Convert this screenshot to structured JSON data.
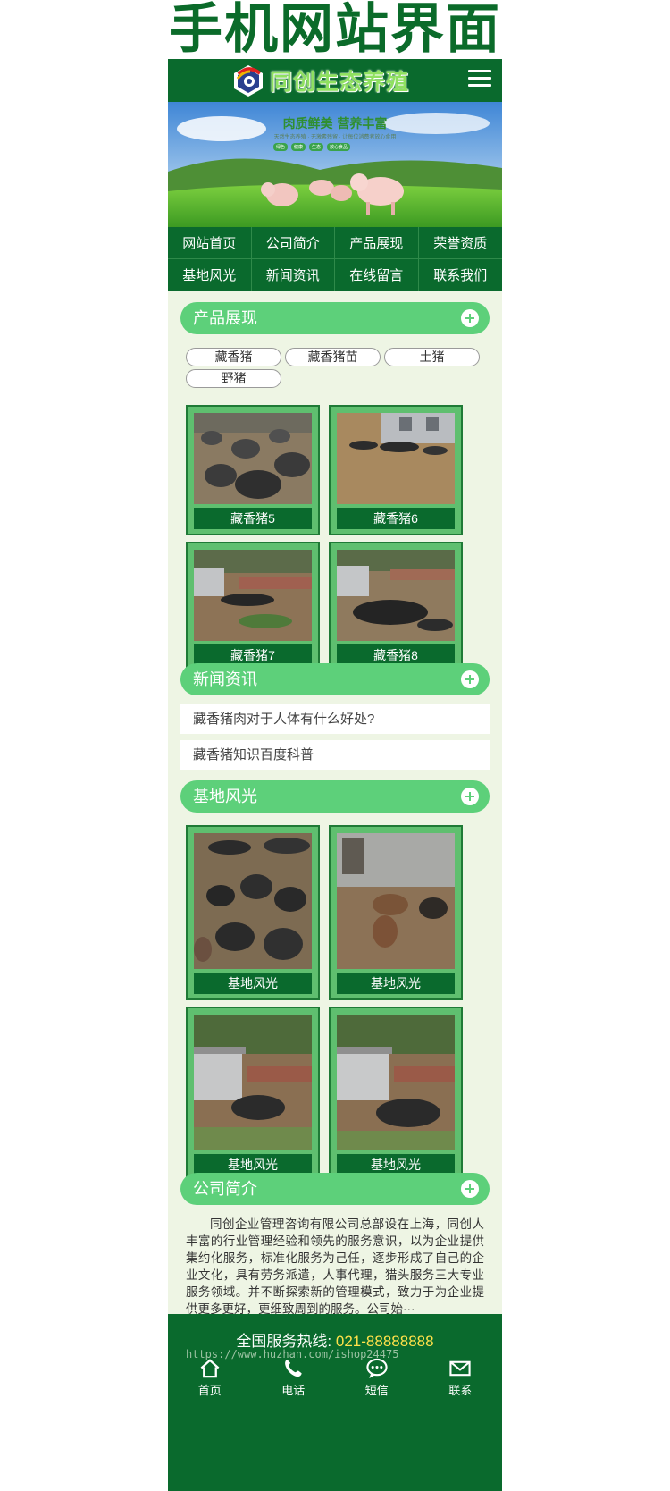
{
  "banner": {
    "title": "手机网站界面"
  },
  "header": {
    "logo_text": "同创生态养殖"
  },
  "hero": {
    "headline": "肉质鲜美  营养丰富",
    "subline": "天然生态养殖 · 无激素残留 · 让每位消费者放心食用",
    "pills": [
      "绿色",
      "健康",
      "生态",
      "放心食品"
    ]
  },
  "nav": {
    "items": [
      {
        "label": "网站首页"
      },
      {
        "label": "公司简介"
      },
      {
        "label": "产品展现"
      },
      {
        "label": "荣誉资质"
      },
      {
        "label": "基地风光"
      },
      {
        "label": "新闻资讯"
      },
      {
        "label": "在线留言"
      },
      {
        "label": "联系我们"
      }
    ]
  },
  "products": {
    "title": "产品展现",
    "tags": [
      {
        "label": "藏香猪"
      },
      {
        "label": "藏香猪苗"
      },
      {
        "label": "土猪"
      },
      {
        "label": "野猪"
      }
    ],
    "cards": [
      {
        "caption": "藏香猪5"
      },
      {
        "caption": "藏香猪6"
      },
      {
        "caption": "藏香猪7"
      },
      {
        "caption": "藏香猪8"
      }
    ]
  },
  "news": {
    "title": "新闻资讯",
    "items": [
      {
        "title": "藏香猪肉对于人体有什么好处?"
      },
      {
        "title": "藏香猪知识百度科普"
      }
    ]
  },
  "scenery": {
    "title": "基地风光",
    "cards": [
      {
        "caption": "基地风光"
      },
      {
        "caption": "基地风光"
      },
      {
        "caption": "基地风光"
      },
      {
        "caption": "基地风光"
      }
    ]
  },
  "about": {
    "title": "公司简介",
    "text": "同创企业管理咨询有限公司总部设在上海，同创人丰富的行业管理经验和领先的服务意识，以为企业提供集约化服务，标准化服务为己任，逐步形成了自己的企业文化，具有劳务派遣，人事代理，猎头服务三大专业服务领域。并不断探索新的管理模式，致力于为企业提供更多更好，更细致周到的服务。公司始···"
  },
  "footer": {
    "hotline_label": "全国服务热线:",
    "hotline_number": "021-88888888",
    "watermark": "https://www.huzhan.com/ishop24475",
    "bar": [
      {
        "label": "首页",
        "icon": "home-icon"
      },
      {
        "label": "电话",
        "icon": "phone-icon"
      },
      {
        "label": "短信",
        "icon": "sms-icon"
      },
      {
        "label": "联系",
        "icon": "mail-icon"
      }
    ]
  },
  "colors": {
    "primary": "#0a6a2d",
    "accent": "#5dd07a",
    "page_bg": "#eef5e4",
    "hotline": "#ffe14a"
  }
}
